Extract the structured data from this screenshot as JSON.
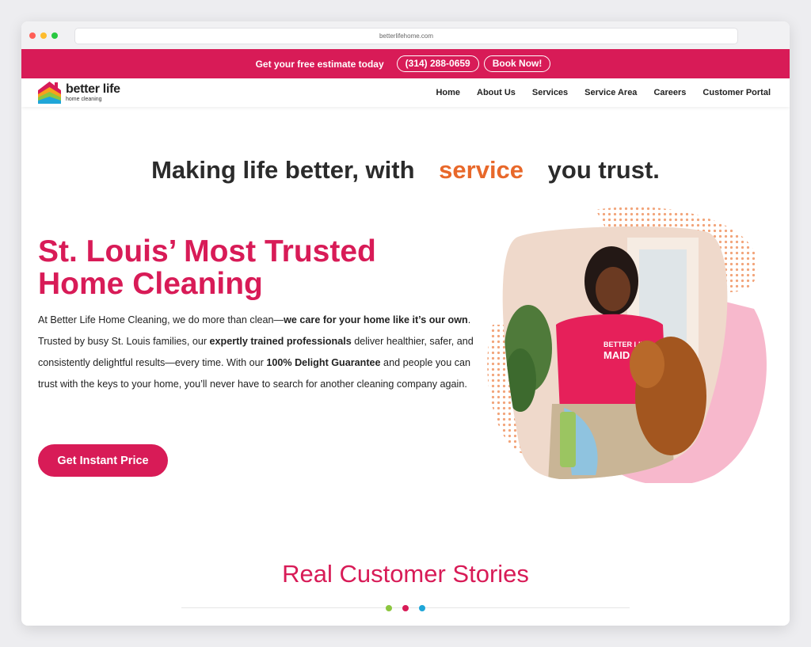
{
  "browser": {
    "url": "betterlifehome.com"
  },
  "topbar": {
    "estimate_text": "Get your free estimate today",
    "phone_label": "(314) 288-0659",
    "book_label": "Book Now!"
  },
  "brand": {
    "name": "better life",
    "sub": "home cleaning",
    "primary_color": "#d81b57",
    "accent_color": "#e8682a"
  },
  "nav": {
    "items": [
      {
        "label": "Home"
      },
      {
        "label": "About Us"
      },
      {
        "label": "Services"
      },
      {
        "label": "Service Area"
      },
      {
        "label": "Careers"
      },
      {
        "label": "Customer Portal"
      }
    ]
  },
  "tagline": {
    "before": "Making life better, with",
    "accent": "service",
    "after": "you trust."
  },
  "hero": {
    "title_line1": "St. Louis’ Most Trusted",
    "title_line2": "Home Cleaning",
    "body": [
      "At Better Life Home Cleaning, we do more than clean—",
      "we care for your home like it’s our own",
      ". Trusted by busy St. Louis families, our ",
      "expertly trained professionals",
      " deliver healthier, safer, and consistently delightful results—every time. With our ",
      "100% Delight Guarantee",
      " and people you can trust with the keys to your home, you’ll never have to search for another cleaning company again."
    ],
    "cta_label": "Get Instant Price",
    "shirt_text_line1": "BETTER LIFE",
    "shirt_text_line2": "MAID"
  },
  "stories": {
    "title": "Real Customer Stories",
    "dot_colors": [
      "#8cc63f",
      "#d81b57",
      "#1fa6d8"
    ]
  }
}
